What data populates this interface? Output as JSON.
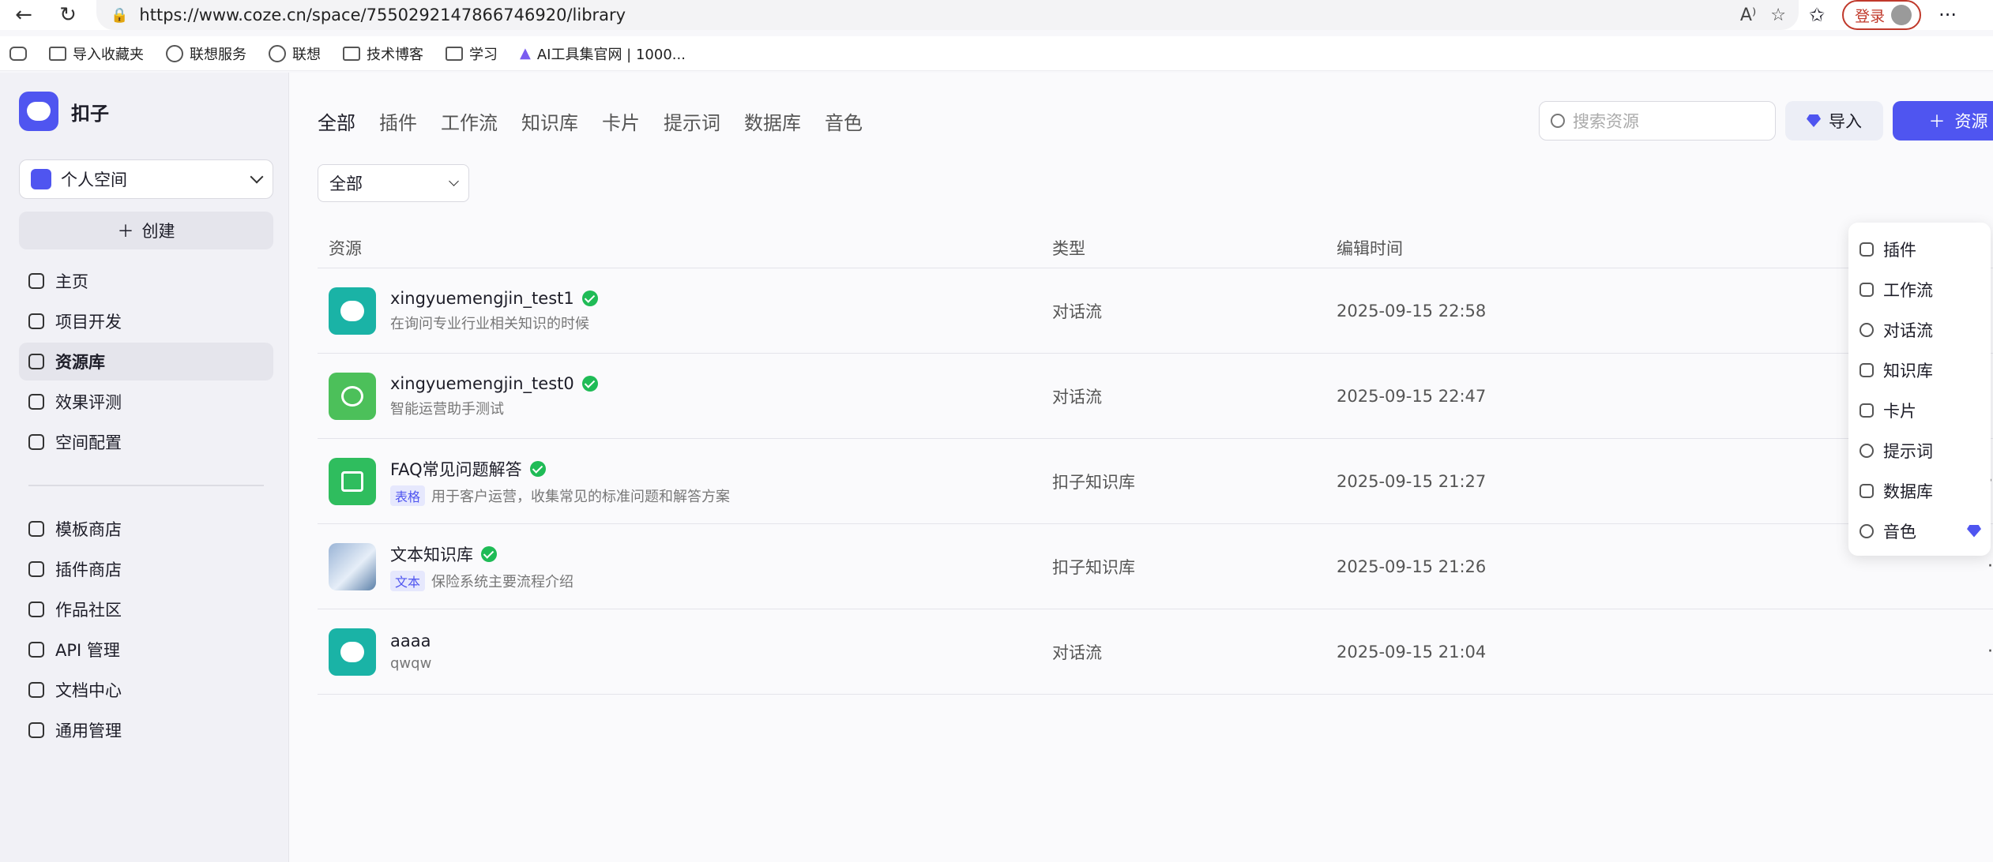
{
  "browser": {
    "url": "https://www.coze.cn/space/7550292147866746920/library",
    "login_label": "登录",
    "bookmarks": [
      "导入收藏夹",
      "联想服务",
      "联想",
      "技术博客",
      "学习",
      "AI工具集官网 | 1000..."
    ]
  },
  "sidebar": {
    "brand": "扣子",
    "space": "个人空间",
    "create_label": "创建",
    "items": [
      {
        "label": "主页",
        "icon": "home-icon"
      },
      {
        "label": "项目开发",
        "icon": "robot-icon"
      },
      {
        "label": "资源库",
        "icon": "library-icon"
      },
      {
        "label": "效果评测",
        "icon": "gauge-icon"
      },
      {
        "label": "空间配置",
        "icon": "terminal-icon"
      }
    ],
    "items2": [
      {
        "label": "模板商店",
        "icon": "template-icon"
      },
      {
        "label": "插件商店",
        "icon": "plugin-icon"
      },
      {
        "label": "作品社区",
        "icon": "community-icon"
      },
      {
        "label": "API 管理",
        "icon": "api-icon"
      },
      {
        "label": "文档中心",
        "icon": "doc-icon"
      },
      {
        "label": "通用管理",
        "icon": "inbox-icon"
      }
    ]
  },
  "main": {
    "tabs": [
      "全部",
      "插件",
      "工作流",
      "知识库",
      "卡片",
      "提示词",
      "数据库",
      "音色"
    ],
    "search_placeholder": "搜索资源",
    "import_label": "导入",
    "resource_label": "资源",
    "filter_value": "全部",
    "columns": [
      "资源",
      "类型",
      "编辑时间"
    ],
    "rows": [
      {
        "name": "xingyuemengjin_test1",
        "desc": "在询问专业行业相关知识的时候",
        "tag": "",
        "type": "对话流",
        "time": "2025-09-15 22:58"
      },
      {
        "name": "xingyuemengjin_test0",
        "desc": "智能运营助手测试",
        "tag": "",
        "type": "对话流",
        "time": "2025-09-15 22:47"
      },
      {
        "name": "FAQ常见问题解答",
        "desc": "用于客户运营，收集常见的标准问题和解答方案",
        "tag": "表格",
        "type": "扣子知识库",
        "time": "2025-09-15 21:27"
      },
      {
        "name": "文本知识库",
        "desc": "保险系统主要流程介绍",
        "tag": "文本",
        "type": "扣子知识库",
        "time": "2025-09-15 21:26"
      },
      {
        "name": "aaaa",
        "desc": "qwqw",
        "tag": "",
        "type": "对话流",
        "time": "2025-09-15 21:04"
      }
    ]
  },
  "dropdown": {
    "items": [
      "插件",
      "工作流",
      "对话流",
      "知识库",
      "卡片",
      "提示词",
      "数据库",
      "音色"
    ]
  },
  "colors": {
    "accent": "#4f55f0",
    "verified": "#1fbb56"
  }
}
